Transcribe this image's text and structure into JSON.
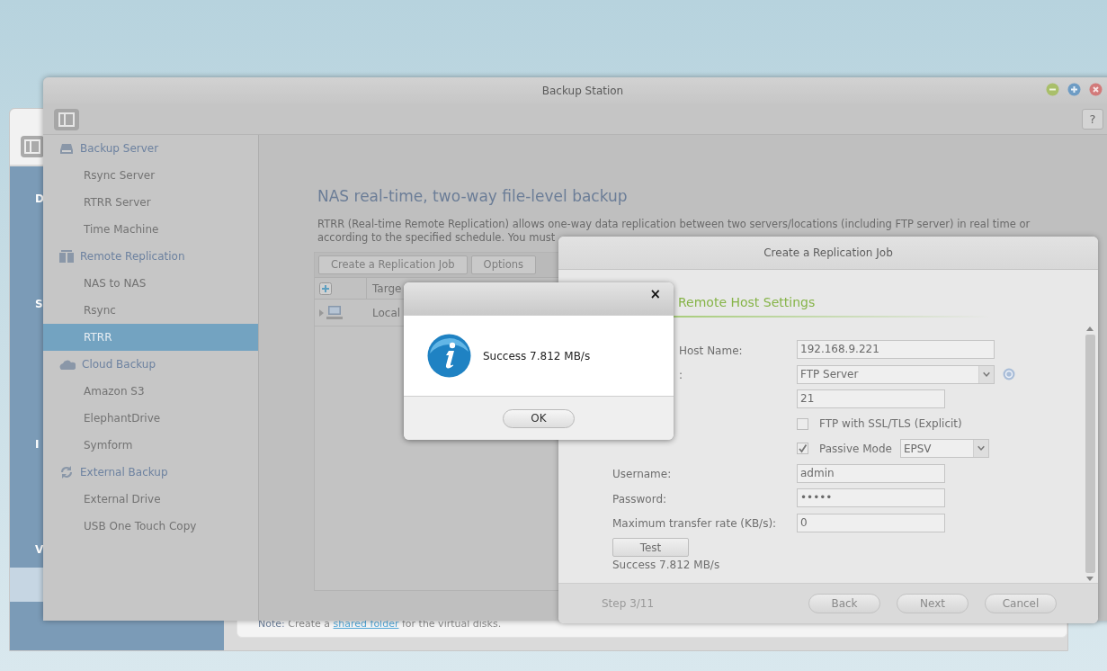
{
  "back_window": {
    "sidebar_labels": [
      "D",
      "S",
      "I",
      "V"
    ],
    "note": {
      "label": "Note:",
      "before": "Create a",
      "link": "shared folder",
      "after": "for the virtual disks."
    }
  },
  "window": {
    "title": "Backup Station",
    "help": "?"
  },
  "sidebar": {
    "groups": [
      {
        "label": "Backup Server",
        "kind": "drive",
        "items": [
          {
            "label": "Rsync Server",
            "selected": false
          },
          {
            "label": "RTRR Server",
            "selected": false
          },
          {
            "label": "Time Machine",
            "selected": false
          }
        ]
      },
      {
        "label": "Remote Replication",
        "kind": "servers",
        "items": [
          {
            "label": "NAS to NAS",
            "selected": false
          },
          {
            "label": "Rsync",
            "selected": false
          },
          {
            "label": "RTRR",
            "selected": true
          }
        ]
      },
      {
        "label": "Cloud Backup",
        "kind": "cloud",
        "items": [
          {
            "label": "Amazon S3",
            "selected": false
          },
          {
            "label": "ElephantDrive",
            "selected": false
          },
          {
            "label": "Symform",
            "selected": false
          }
        ]
      },
      {
        "label": "External Backup",
        "kind": "sync",
        "items": [
          {
            "label": "External Drive",
            "selected": false
          },
          {
            "label": "USB One Touch Copy",
            "selected": false
          }
        ]
      }
    ]
  },
  "content": {
    "heading": "NAS real-time, two-way file-level backup",
    "description": [
      "RTRR (Real-time Remote Replication) allows one-way data replication between two servers/locations (including FTP server) in real time or",
      "according to the specified schedule. You must"
    ],
    "buttons": [
      "Create a Replication Job",
      "Options"
    ],
    "table": {
      "columns": [
        "Targe"
      ],
      "rows": [
        {
          "cells": [
            "Local"
          ]
        }
      ]
    }
  },
  "replication_dialog": {
    "title": "Create a Replication Job",
    "section": "Remote Host Settings",
    "fields": [
      {
        "kind": "text",
        "label": "Host Name:",
        "value": "192.168.9.221",
        "wide": true
      },
      {
        "kind": "select",
        "label": ":",
        "value": "FTP Server",
        "help": true
      },
      {
        "kind": "text",
        "value": "21"
      },
      {
        "kind": "checkbox",
        "label": "FTP with SSL/TLS (Explicit)",
        "checked": false
      },
      {
        "kind": "checkbox",
        "label": "Passive Mode",
        "checked": true,
        "select": "EPSV"
      },
      {
        "kind": "text",
        "label": "Username:",
        "value": "admin"
      },
      {
        "kind": "text",
        "label": "Password:",
        "value": "•••••"
      },
      {
        "kind": "text",
        "label": "Maximum transfer rate (KB/s):",
        "value": "0"
      }
    ],
    "test_button": "Test",
    "test_result": "Success 7.812 MB/s",
    "step": "Step 3/11",
    "buttons": [
      "Back",
      "Next",
      "Cancel"
    ]
  },
  "message_box": {
    "close": "×",
    "message": "Success 7.812 MB/s",
    "button": "OK"
  }
}
